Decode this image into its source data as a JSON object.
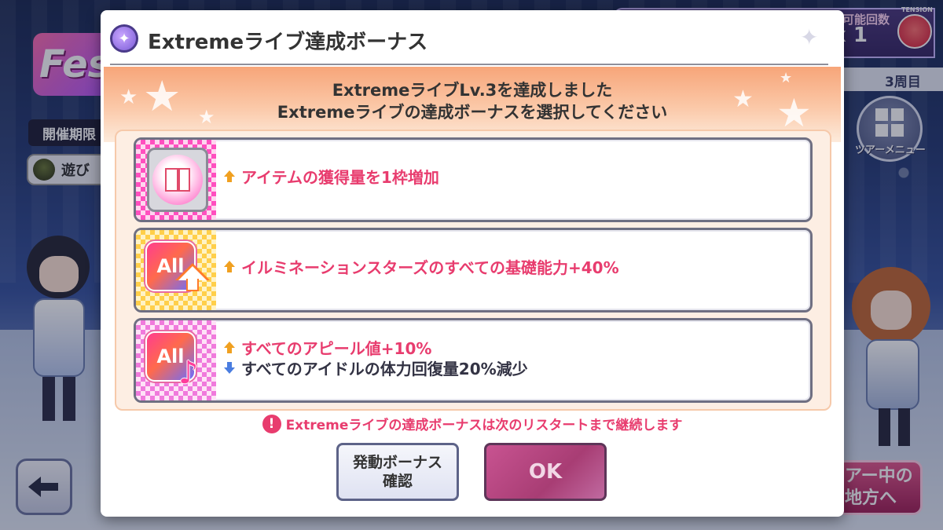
{
  "background": {
    "logo_text": "Fes",
    "period_label": "開催期限",
    "play_label": "遊び",
    "tension": {
      "label": "可能回数",
      "count": "x 1",
      "word": "TENSION"
    },
    "lap_label": "3周目",
    "tour_menu_label": "ツアーメニュー",
    "tour_area_button": "アー中の\n地方へ"
  },
  "modal": {
    "title": "Extremeライブ達成ボーナス",
    "banner": {
      "line1": "ExtremeライブLv.3を達成しました",
      "line2": "Extremeライブの達成ボーナスを選択してください"
    },
    "options": [
      {
        "icon": "gift-icon",
        "effects": [
          {
            "direction": "up",
            "text": "アイテムの獲得量を1枠増加"
          }
        ]
      },
      {
        "icon": "all-up-icon",
        "tile_text": "All",
        "effects": [
          {
            "direction": "up",
            "text": "イルミネーションスターズのすべての基礎能力+40%"
          }
        ]
      },
      {
        "icon": "all-note-icon",
        "tile_text": "All",
        "effects": [
          {
            "direction": "up",
            "text": "すべてのアピール値+10%"
          },
          {
            "direction": "down",
            "text": "すべてのアイドルの体力回復量20%減少"
          }
        ]
      }
    ],
    "notice": "Extremeライブの達成ボーナスは次のリスタートまで継続します",
    "buttons": {
      "bonus_line1": "発動ボーナス",
      "bonus_line2": "確認",
      "ok": "OK"
    }
  },
  "colors": {
    "accent_pink": "#e83c6e",
    "banner_orange": "#f7a579",
    "ok_button": "#a83d74"
  }
}
